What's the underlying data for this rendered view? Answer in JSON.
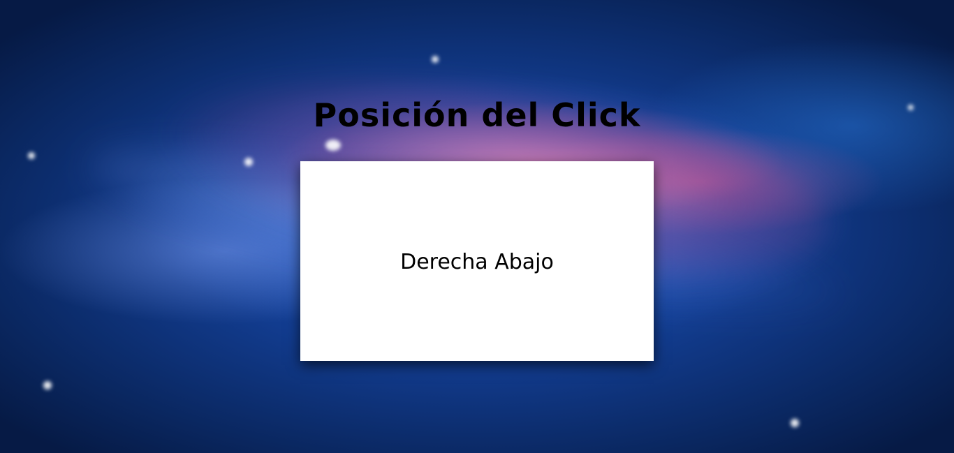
{
  "page": {
    "title": "Posición del Click",
    "click_area": {
      "label": "Derecha Abajo"
    }
  },
  "colors": {
    "background_primary": "#123c8f",
    "card": "#ffffff",
    "text": "#000000"
  }
}
